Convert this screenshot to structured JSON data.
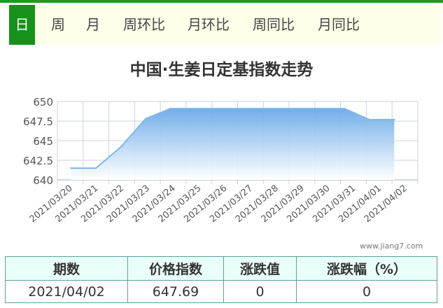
{
  "tabs": [
    {
      "label": "日",
      "active": true
    },
    {
      "label": "周",
      "active": false
    },
    {
      "label": "月",
      "active": false
    },
    {
      "label": "周环比",
      "active": false
    },
    {
      "label": "月环比",
      "active": false
    },
    {
      "label": "周同比",
      "active": false
    },
    {
      "label": "月同比",
      "active": false
    }
  ],
  "colors": {
    "accent_green": "#16921a",
    "series": "#7fb6ea"
  },
  "chart_data": {
    "type": "area",
    "title": "中国·生姜日定基指数走势",
    "categories": [
      "2021/03/20",
      "2021/03/21",
      "2021/03/22",
      "2021/03/23",
      "2021/03/24",
      "2021/03/25",
      "2021/03/26",
      "2021/03/27",
      "2021/03/28",
      "2021/03/29",
      "2021/03/30",
      "2021/03/31",
      "2021/04/01",
      "2021/04/02"
    ],
    "values": [
      641.5,
      641.5,
      644.2,
      647.8,
      649.1,
      649.1,
      649.1,
      649.1,
      649.1,
      649.1,
      649.1,
      649.1,
      647.69,
      647.69
    ],
    "yticks": [
      "640",
      "642.5",
      "645",
      "647.5",
      "650"
    ],
    "ylim": [
      640,
      650
    ],
    "grid": true,
    "legend": "none"
  },
  "watermark": "www.jiang7.com",
  "table": {
    "headers": [
      "期数",
      "价格指数",
      "涨跌值",
      "涨跌幅（%）"
    ],
    "row": [
      "2021/04/02",
      "647.69",
      "0",
      "0"
    ]
  }
}
